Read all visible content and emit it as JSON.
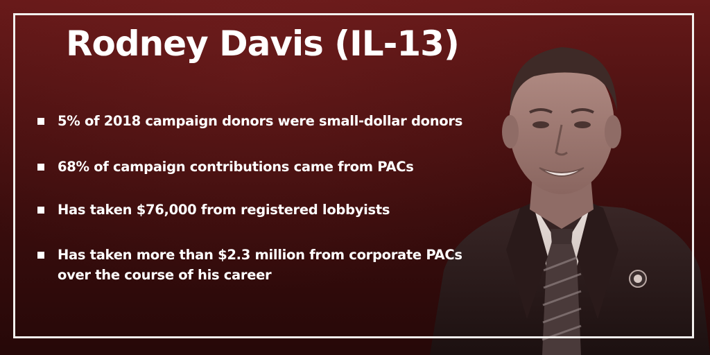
{
  "title": "Rodney Davis (IL-13)",
  "facts": [
    "5% of 2018 campaign donors were small-dollar donors",
    "68% of campaign contributions came from PACs",
    "Has taken $76,000 from registered lobbyists",
    "Has taken more than $2.3 million from corporate PACs over the course of his career"
  ],
  "colors": {
    "background": "#5a1515",
    "frame": "#f3f0ee",
    "text": "#ffffff"
  },
  "portrait": {
    "subject": "Rodney Davis",
    "description_icon": "portrait-photo"
  }
}
